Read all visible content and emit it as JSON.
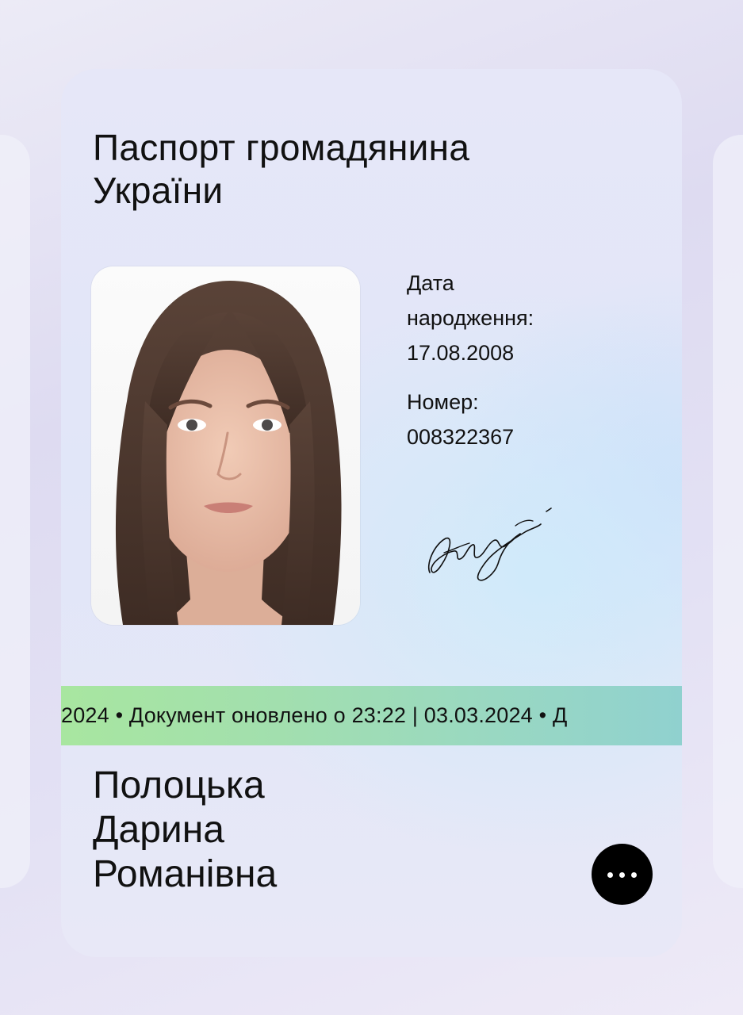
{
  "document": {
    "title_line1": "Паспорт громадянина",
    "title_line2": "України",
    "birth_date_label_line1": "Дата",
    "birth_date_label_line2": "народження:",
    "birth_date": "17.08.2008",
    "number_label": "Номер:",
    "number": "008322367",
    "ticker_text": "2024 • Документ оновлено о 23:22 | 03.03.2024 • Д",
    "surname": "Полоцька",
    "given_name": "Дарина",
    "patronymic": "Романівна",
    "more_icon": "more-horizontal-icon"
  },
  "colors": {
    "background": "#e3e1f4",
    "card": "#e3e6f8",
    "ticker_start": "#a8e6a0",
    "ticker_end": "#90d1cf",
    "button": "#000000",
    "text": "#111111"
  }
}
